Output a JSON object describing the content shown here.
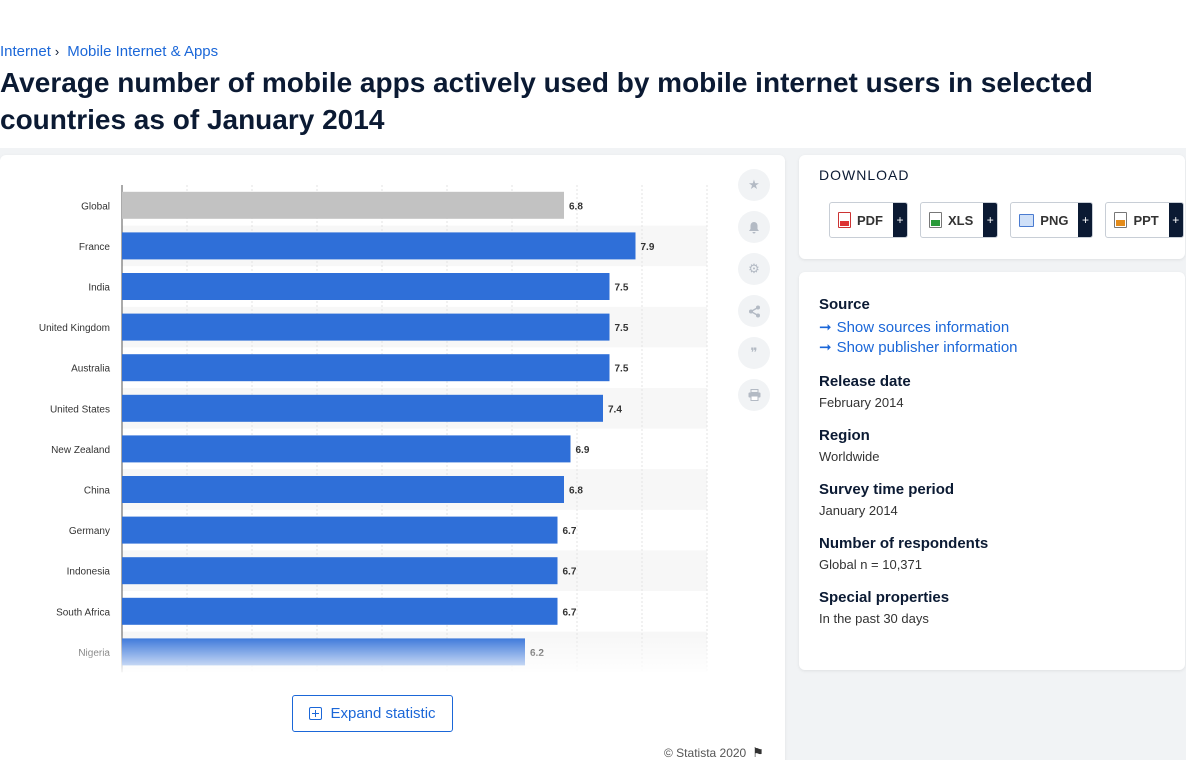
{
  "breadcrumb": {
    "items": [
      "Internet",
      "Mobile Internet & Apps"
    ],
    "separator": "›"
  },
  "page_title": "Average number of mobile apps actively used by mobile internet users in selected countries as of January 2014",
  "chart_actions": {
    "expand_label": "Expand statistic",
    "copyright": "© Statista 2020"
  },
  "side_tools": [
    "star-icon",
    "bell-icon",
    "gear-icon",
    "share-icon",
    "quote-icon",
    "print-icon"
  ],
  "download": {
    "title": "DOWNLOAD",
    "formats": [
      {
        "label": "PDF",
        "plus": "+"
      },
      {
        "label": "XLS",
        "plus": "+"
      },
      {
        "label": "PNG",
        "plus": "+"
      },
      {
        "label": "PPT",
        "plus": "+"
      }
    ]
  },
  "info": {
    "source_label": "Source",
    "show_sources": "Show sources information",
    "show_publisher": "Show publisher information",
    "release_date_label": "Release date",
    "release_date": "February 2014",
    "region_label": "Region",
    "region": "Worldwide",
    "survey_period_label": "Survey time period",
    "survey_period": "January 2014",
    "respondents_label": "Number of respondents",
    "respondents": "Global n = 10,371",
    "special_label": "Special properties",
    "special": "In the past 30 days"
  },
  "colors": {
    "bar": "#2f6fd8",
    "highlight_bar": "#c2c2c2",
    "link": "#1b67d8"
  },
  "chart_data": {
    "type": "bar",
    "orientation": "horizontal",
    "categories": [
      "Global",
      "France",
      "India",
      "United Kingdom",
      "Australia",
      "United States",
      "New Zealand",
      "China",
      "Germany",
      "Indonesia",
      "South Africa",
      "Nigeria"
    ],
    "values": [
      6.8,
      7.9,
      7.5,
      7.5,
      7.5,
      7.4,
      6.9,
      6.8,
      6.7,
      6.7,
      6.7,
      6.2
    ],
    "data_labels": [
      "6.8",
      "7.9",
      "7.5",
      "7.5",
      "7.5",
      "7.4",
      "6.9",
      "6.8",
      "6.7",
      "6.7",
      "6.7",
      "6.2"
    ],
    "highlighted": [
      "Global"
    ],
    "xlim": [
      0,
      9
    ],
    "grid": true,
    "title": "",
    "xlabel": "",
    "ylabel": ""
  }
}
